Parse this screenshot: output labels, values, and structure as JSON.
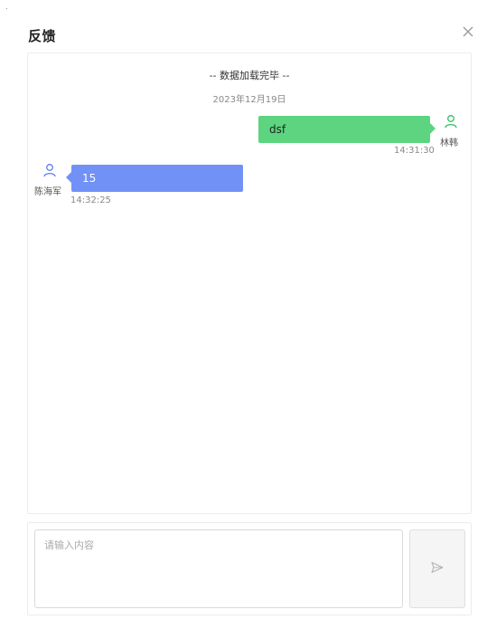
{
  "dialog": {
    "title": "反馈",
    "close_icon": "close-icon"
  },
  "chat": {
    "loaded_text": "-- 数据加载完毕 --",
    "date": "2023年12月19日",
    "messages": [
      {
        "side": "right",
        "sender": "林韩",
        "text": "dsf",
        "time": "14:31:30",
        "bubble_color": "#5dd47f",
        "avatar_icon": "user-icon",
        "avatar_color": "#2fbf60"
      },
      {
        "side": "left",
        "sender": "陈海军",
        "text": "15",
        "time": "14:32:25",
        "bubble_color": "#7191f6",
        "avatar_icon": "user-icon",
        "avatar_color": "#5b7ef0"
      }
    ]
  },
  "composer": {
    "placeholder": "请输入内容",
    "value": "",
    "send_icon": "send-icon"
  }
}
